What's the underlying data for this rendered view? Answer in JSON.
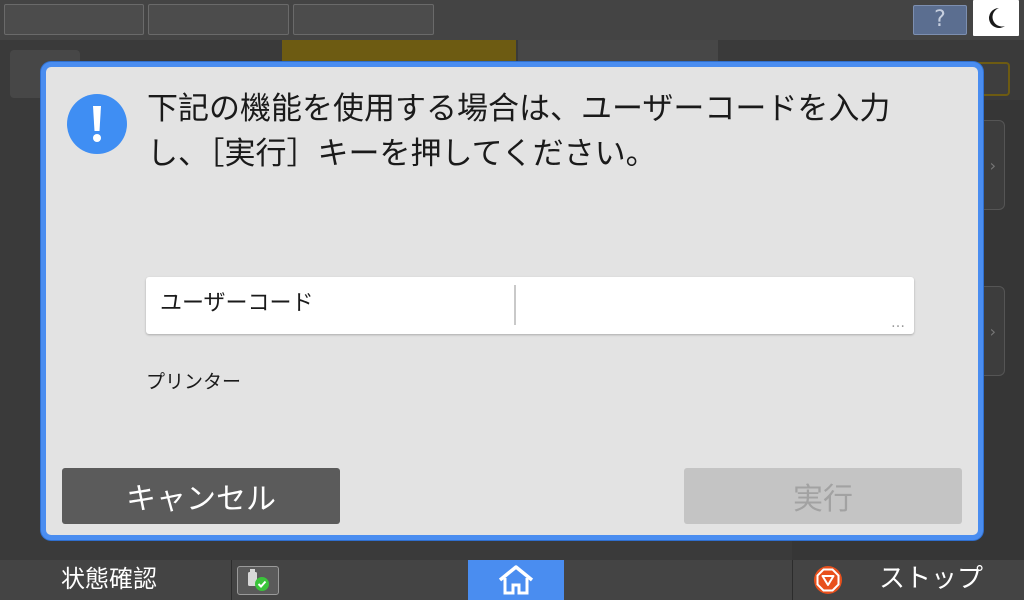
{
  "dialog": {
    "message_line1": "下記の機能を使用する場合は、ユーザーコードを入力",
    "message_line2": "し、［実行］キーを押してください。",
    "user_code_label": "ユーザーコード",
    "user_code_value": "",
    "field_more": "…",
    "function_name": "プリンター",
    "cancel_label": "キャンセル",
    "execute_label": "実行"
  },
  "topbar": {
    "help_label": "?"
  },
  "bottombar": {
    "status_label": "状態確認",
    "stop_label": "ストップ"
  },
  "colors": {
    "accent": "#4a8df0",
    "stop": "#e8501c",
    "job_ok": "#3ac43a"
  }
}
